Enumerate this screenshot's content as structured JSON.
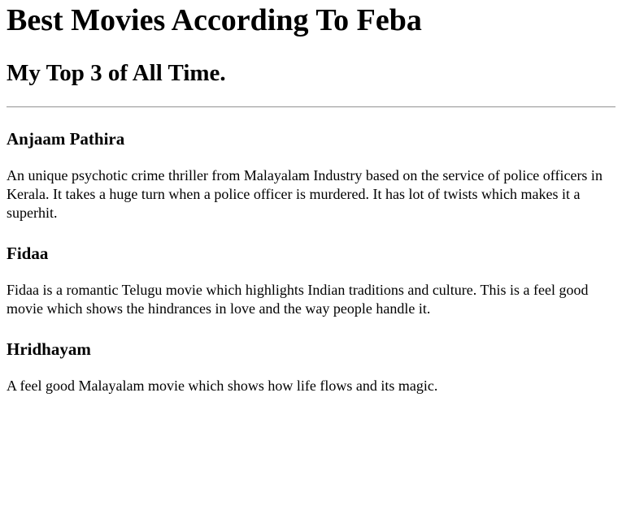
{
  "page": {
    "title": "Best Movies According To Feba",
    "subtitle": "My Top 3 of All Time."
  },
  "movies": [
    {
      "title": "Anjaam Pathira",
      "description": "An unique psychotic crime thriller from Malayalam Industry based on the service of police officers in Kerala. It takes a huge turn when a police officer is murdered. It has lot of twists which makes it a superhit."
    },
    {
      "title": "Fidaa",
      "description": "Fidaa is a romantic Telugu movie which highlights Indian traditions and culture. This is a feel good movie which shows the hindrances in love and the way people handle it."
    },
    {
      "title": "Hridhayam",
      "description": "A feel good Malayalam movie which shows how life flows and its magic."
    }
  ]
}
